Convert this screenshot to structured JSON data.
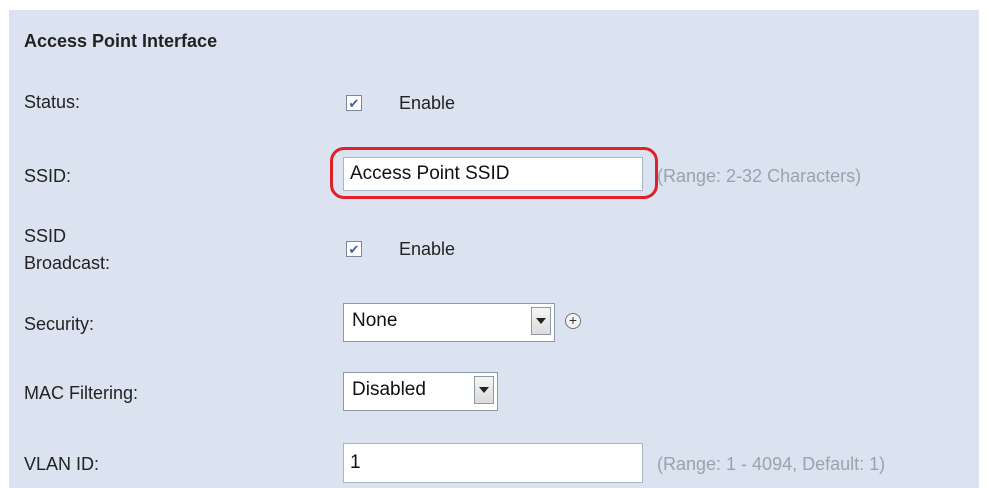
{
  "section": {
    "title": "Access Point Interface"
  },
  "status": {
    "label": "Status:",
    "checked": true,
    "check_text": "Enable"
  },
  "ssid": {
    "label": "SSID:",
    "value": "Access Point SSID",
    "hint": "(Range: 2-32 Characters)"
  },
  "ssid_broadcast": {
    "label_line1": "SSID",
    "label_line2": "Broadcast:",
    "checked": true,
    "check_text": "Enable"
  },
  "security": {
    "label": "Security:",
    "selected": "None",
    "more_icon": "plus-icon"
  },
  "mac_filtering": {
    "label": "MAC Filtering:",
    "selected": "Disabled"
  },
  "vlan": {
    "label": "VLAN ID:",
    "value": "1",
    "hint": "(Range: 1 - 4094, Default: 1)"
  },
  "colors": {
    "panel_bg": "#dae3ef",
    "highlight": "#e01f26",
    "hint_text": "#9aa3ad"
  }
}
